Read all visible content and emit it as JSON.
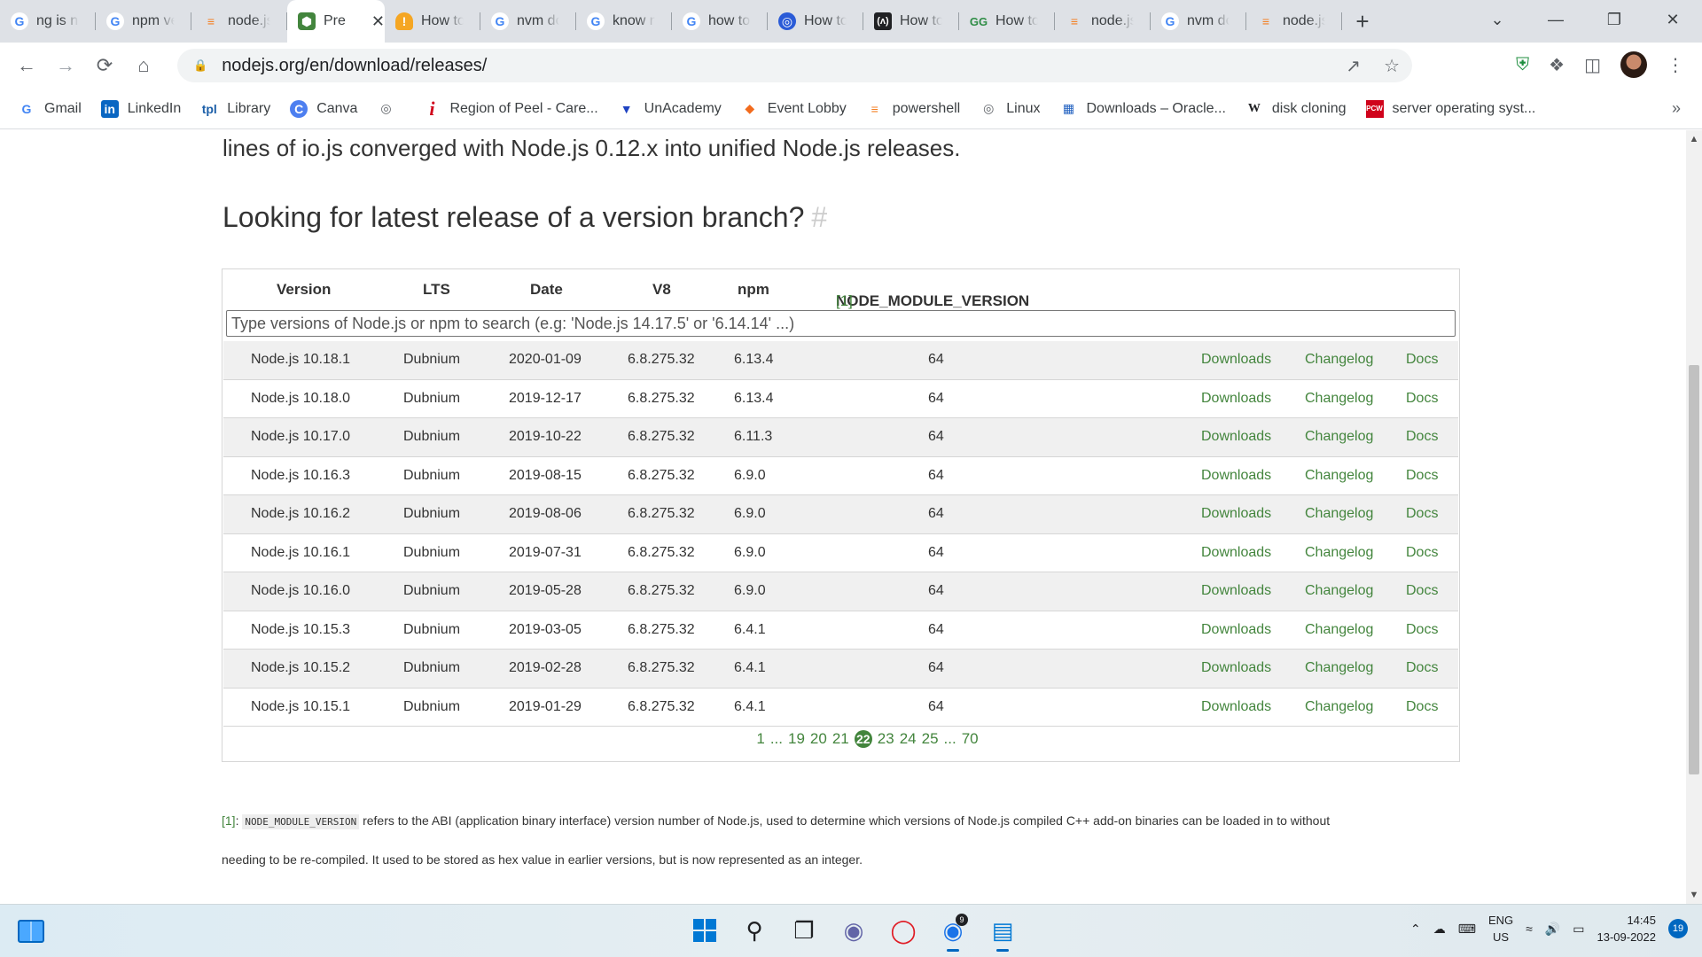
{
  "browser": {
    "tabs": [
      {
        "title": "ng is nc",
        "icon": "google-icon"
      },
      {
        "title": "npm ve",
        "icon": "google-icon"
      },
      {
        "title": "node.js",
        "icon": "stackoverflow-icon"
      },
      {
        "title": "Pre",
        "icon": "nodejs-icon",
        "active": true
      },
      {
        "title": "How to",
        "icon": "warning-icon"
      },
      {
        "title": "nvm do",
        "icon": "google-icon"
      },
      {
        "title": "know n",
        "icon": "google-icon"
      },
      {
        "title": "how to",
        "icon": "google-icon"
      },
      {
        "title": "How to",
        "icon": "globe-icon"
      },
      {
        "title": "How to",
        "icon": "dev-icon"
      },
      {
        "title": "How to",
        "icon": "geeksforgeeks-icon"
      },
      {
        "title": "node.js",
        "icon": "stackoverflow-icon"
      },
      {
        "title": "nvm dc",
        "icon": "google-icon"
      },
      {
        "title": "node.js",
        "icon": "stackoverflow-icon"
      }
    ],
    "url": "nodejs.org/en/download/releases/",
    "bookmarks": [
      {
        "label": "Gmail",
        "icon": "google-icon"
      },
      {
        "label": "LinkedIn",
        "icon": "linkedin-icon"
      },
      {
        "label": "Library",
        "icon": "tpl-icon"
      },
      {
        "label": "Canva",
        "icon": "canva-icon"
      },
      {
        "label": "",
        "icon": "globe-icon"
      },
      {
        "label": "Region of Peel - Care...",
        "icon": "info-icon"
      },
      {
        "label": "UnAcademy",
        "icon": "unacademy-icon"
      },
      {
        "label": "Event Lobby",
        "icon": "flame-icon"
      },
      {
        "label": "powershell",
        "icon": "stackoverflow-icon"
      },
      {
        "label": "Linux",
        "icon": "globe-icon"
      },
      {
        "label": "Downloads – Oracle...",
        "icon": "oracle-icon"
      },
      {
        "label": "disk cloning",
        "icon": "wikipedia-icon"
      },
      {
        "label": "server operating syst...",
        "icon": "pcw-icon"
      }
    ]
  },
  "page": {
    "intro": "lines of io.js converged with Node.js 0.12.x into unified Node.js releases.",
    "heading": "Looking for latest release of a version branch?",
    "heading_hash": "#",
    "columns": {
      "version": "Version",
      "lts": "LTS",
      "date": "Date",
      "v8": "V8",
      "npm": "npm",
      "module": "NODE_MODULE_VERSION",
      "module_ref": "[1]"
    },
    "search_placeholder": "Type versions of Node.js or npm to search (e.g: 'Node.js 14.17.5' or '6.14.14' ...)",
    "links": {
      "downloads": "Downloads",
      "changelog": "Changelog",
      "docs": "Docs"
    },
    "rows": [
      {
        "version": "Node.js 10.18.1",
        "lts": "Dubnium",
        "date": "2020-01-09",
        "v8": "6.8.275.32",
        "npm": "6.13.4",
        "module": "64"
      },
      {
        "version": "Node.js 10.18.0",
        "lts": "Dubnium",
        "date": "2019-12-17",
        "v8": "6.8.275.32",
        "npm": "6.13.4",
        "module": "64"
      },
      {
        "version": "Node.js 10.17.0",
        "lts": "Dubnium",
        "date": "2019-10-22",
        "v8": "6.8.275.32",
        "npm": "6.11.3",
        "module": "64"
      },
      {
        "version": "Node.js 10.16.3",
        "lts": "Dubnium",
        "date": "2019-08-15",
        "v8": "6.8.275.32",
        "npm": "6.9.0",
        "module": "64"
      },
      {
        "version": "Node.js 10.16.2",
        "lts": "Dubnium",
        "date": "2019-08-06",
        "v8": "6.8.275.32",
        "npm": "6.9.0",
        "module": "64"
      },
      {
        "version": "Node.js 10.16.1",
        "lts": "Dubnium",
        "date": "2019-07-31",
        "v8": "6.8.275.32",
        "npm": "6.9.0",
        "module": "64"
      },
      {
        "version": "Node.js 10.16.0",
        "lts": "Dubnium",
        "date": "2019-05-28",
        "v8": "6.8.275.32",
        "npm": "6.9.0",
        "module": "64"
      },
      {
        "version": "Node.js 10.15.3",
        "lts": "Dubnium",
        "date": "2019-03-05",
        "v8": "6.8.275.32",
        "npm": "6.4.1",
        "module": "64"
      },
      {
        "version": "Node.js 10.15.2",
        "lts": "Dubnium",
        "date": "2019-02-28",
        "v8": "6.8.275.32",
        "npm": "6.4.1",
        "module": "64"
      },
      {
        "version": "Node.js 10.15.1",
        "lts": "Dubnium",
        "date": "2019-01-29",
        "v8": "6.8.275.32",
        "npm": "6.4.1",
        "module": "64"
      }
    ],
    "pagination": {
      "items": [
        "1",
        "...",
        "19",
        "20",
        "21",
        "22",
        "23",
        "24",
        "25",
        "...",
        "70"
      ],
      "current": "22"
    },
    "footnote": {
      "ref": "[1]",
      "sep": ":",
      "code": "NODE_MODULE_VERSION",
      "line1": "refers to the ABI (application binary interface) version number of Node.js, used to determine which versions of Node.js compiled C++ add-on binaries can be loaded in to without",
      "line2": "needing to be re-compiled. It used to be stored as hex value in earlier versions, but is now represented as an integer."
    }
  },
  "taskbar": {
    "lang_1": "ENG",
    "lang_2": "US",
    "time": "14:45",
    "date": "13-09-2022",
    "notifications": "19",
    "chrome_badge": "9"
  },
  "colors": {
    "node_green": "#43853d",
    "tab_strip": "#dee1e6"
  }
}
